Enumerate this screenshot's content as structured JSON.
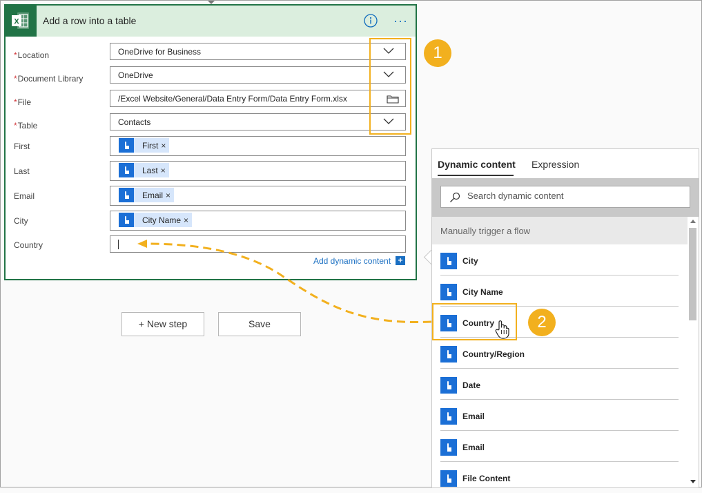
{
  "card": {
    "title": "Add a row into a table",
    "required_marker": "*",
    "fields": [
      {
        "label": "Location",
        "value": "OneDrive for Business",
        "required": true,
        "control": "dropdown"
      },
      {
        "label": "Document Library",
        "value": "OneDrive",
        "required": true,
        "control": "dropdown"
      },
      {
        "label": "File",
        "value": "/Excel Website/General/Data Entry Form/Data Entry Form.xlsx",
        "required": true,
        "control": "folder"
      },
      {
        "label": "Table",
        "value": "Contacts",
        "required": true,
        "control": "dropdown"
      }
    ],
    "token_fields": [
      {
        "label": "First",
        "token": "First"
      },
      {
        "label": "Last",
        "token": "Last"
      },
      {
        "label": "Email",
        "token": "Email"
      },
      {
        "label": "City",
        "token": "City Name"
      }
    ],
    "country": {
      "label": "Country",
      "value": ""
    },
    "token_remove": "×",
    "add_dynamic_content": "Add dynamic content",
    "add_dynamic_plus": "+"
  },
  "buttons": {
    "new_step": "+ New step",
    "save": "Save"
  },
  "badges": {
    "one": "1",
    "two": "2"
  },
  "panel": {
    "tabs": [
      "Dynamic content",
      "Expression"
    ],
    "active_tab": "Dynamic content",
    "search_placeholder": "Search dynamic content",
    "section": "Manually trigger a flow",
    "items": [
      "City",
      "City Name",
      "Country",
      "Country/Region",
      "Date",
      "Email",
      "Email",
      "File Content"
    ]
  },
  "colors": {
    "excel_green": "#217346",
    "header_bg": "#dbeede",
    "token_blue": "#1b6fd6",
    "token_bg": "#d6e6fb",
    "highlight_orange": "#f2b01e",
    "link_blue": "#1a6fc2"
  },
  "icons": [
    "excel-icon",
    "info-icon",
    "more-icon",
    "chevron-down-icon",
    "folder-icon",
    "touch-icon",
    "search-icon",
    "hand-cursor-icon"
  ]
}
